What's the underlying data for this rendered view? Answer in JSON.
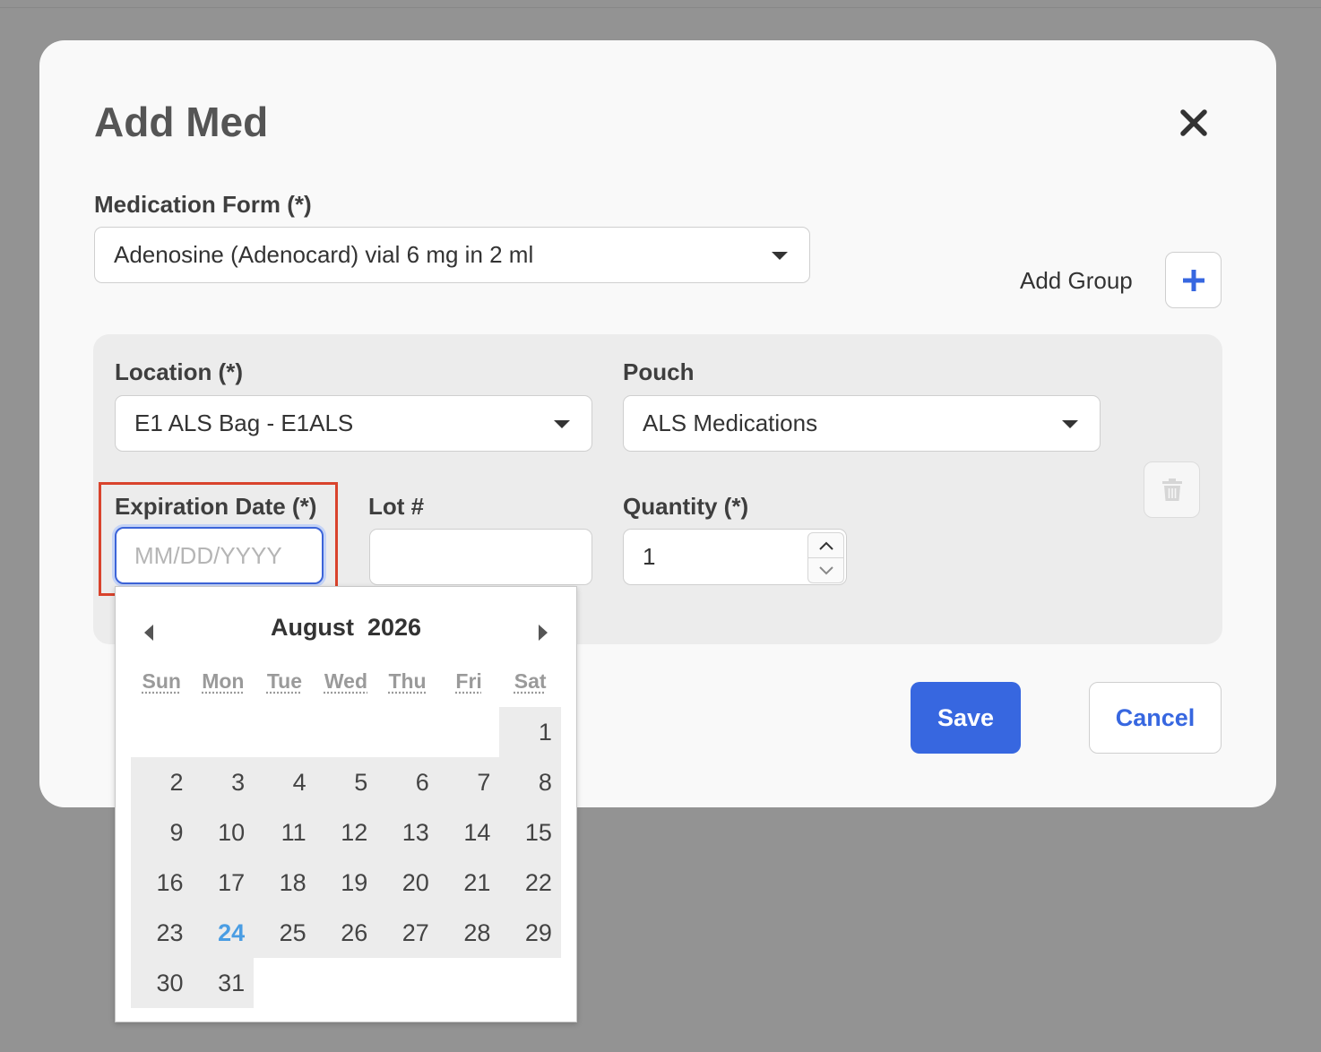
{
  "modal": {
    "title": "Add Med",
    "medication_form": {
      "label": "Medication Form (*)",
      "value": "Adenosine (Adenocard) vial 6 mg in 2 ml"
    },
    "add_group_label": "Add Group",
    "group": {
      "location": {
        "label": "Location (*)",
        "value": "E1 ALS Bag - E1ALS"
      },
      "pouch": {
        "label": "Pouch",
        "value": "ALS Medications"
      },
      "expiration": {
        "label": "Expiration Date (*)",
        "placeholder": "MM/DD/YYYY",
        "value": ""
      },
      "lot": {
        "label": "Lot #",
        "value": ""
      },
      "quantity": {
        "label": "Quantity (*)",
        "value": "1"
      }
    },
    "save_label": "Save",
    "cancel_label": "Cancel",
    "colors": {
      "primary": "#3767e0",
      "highlight": "#d9432c",
      "today": "#4a9de3"
    }
  },
  "calendar": {
    "month": "August",
    "year": "2026",
    "weekdays": [
      "Sun",
      "Mon",
      "Tue",
      "Wed",
      "Thu",
      "Fri",
      "Sat"
    ],
    "weeks": [
      [
        "",
        "",
        "",
        "",
        "",
        "",
        "1"
      ],
      [
        "2",
        "3",
        "4",
        "5",
        "6",
        "7",
        "8"
      ],
      [
        "9",
        "10",
        "11",
        "12",
        "13",
        "14",
        "15"
      ],
      [
        "16",
        "17",
        "18",
        "19",
        "20",
        "21",
        "22"
      ],
      [
        "23",
        "24",
        "25",
        "26",
        "27",
        "28",
        "29"
      ],
      [
        "30",
        "31",
        "",
        "",
        "",
        "",
        ""
      ]
    ],
    "today": "24"
  }
}
